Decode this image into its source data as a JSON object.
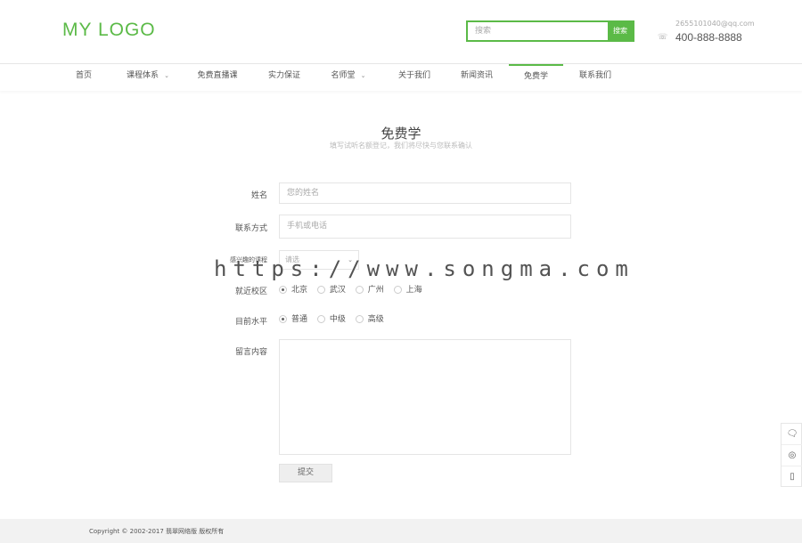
{
  "header": {
    "logo": "MY LOGO",
    "search_placeholder": "搜索",
    "search_button": "搜索",
    "email": "2655101040@qq.com",
    "phone": "400-888-8888",
    "phone_icon": "phone-icon"
  },
  "nav": {
    "items": [
      {
        "label": "首页"
      },
      {
        "label": "课程体系"
      },
      {
        "label": "免费直播课"
      },
      {
        "label": "实力保证"
      },
      {
        "label": "名师堂"
      },
      {
        "label": "关于我们"
      },
      {
        "label": "新闻资讯"
      },
      {
        "label": "免费学"
      },
      {
        "label": "联系我们"
      }
    ],
    "active": "免费学",
    "accent": "#5bba47"
  },
  "page": {
    "title": "免费学",
    "subtitle": "填写试听名额登记，我们将尽快与您联系确认"
  },
  "form": {
    "name_label": "姓名",
    "name_placeholder": "您的姓名",
    "contact_label": "联系方式",
    "contact_placeholder": "手机或电话",
    "course_label": "感兴趣的课程",
    "course_value": "请选",
    "campus_label": "就近校区",
    "campus_options": [
      "北京",
      "武汉",
      "广州",
      "上海"
    ],
    "campus_selected": "北京",
    "level_label": "目前水平",
    "level_options": [
      "普通",
      "中级",
      "高级"
    ],
    "level_selected": "普通",
    "message_label": "留言内容",
    "submit_label": "提交"
  },
  "watermark": "https://www.songma.com",
  "footer": {
    "copyright": "Copyright © 2002-2017 翡翠网络版 版权所有"
  }
}
